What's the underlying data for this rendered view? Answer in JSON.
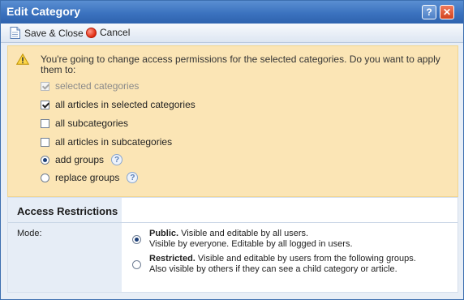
{
  "window": {
    "title": "Edit Category"
  },
  "toolbar": {
    "save_label": "Save & Close",
    "cancel_label": "Cancel"
  },
  "warning": {
    "message": "You're going to change access permissions for the selected categories. Do you want to apply them to:",
    "options": [
      {
        "label": "selected categories",
        "checked": true,
        "disabled": true
      },
      {
        "label": "all articles in selected categories",
        "checked": true,
        "disabled": false
      },
      {
        "label": "all subcategories",
        "checked": false,
        "disabled": false
      },
      {
        "label": "all articles in subcategories",
        "checked": false,
        "disabled": false
      }
    ],
    "group_modes": [
      {
        "label": "add groups",
        "selected": true
      },
      {
        "label": "replace groups",
        "selected": false
      }
    ]
  },
  "access": {
    "title": "Access Restrictions",
    "mode_label": "Mode:",
    "modes": [
      {
        "name": "Public.",
        "line1": "Visible and editable by all users.",
        "line2": "Visible by everyone. Editable by all logged in users.",
        "selected": true
      },
      {
        "name": "Restricted.",
        "line1": "Visible and editable by users from the following groups.",
        "line2": "Also visible by others if they can see a child category or article.",
        "selected": false
      }
    ]
  },
  "colors": {
    "titlebar": "#3b72bf",
    "warning_bg": "#fbe5b5",
    "close": "#d2431f"
  }
}
